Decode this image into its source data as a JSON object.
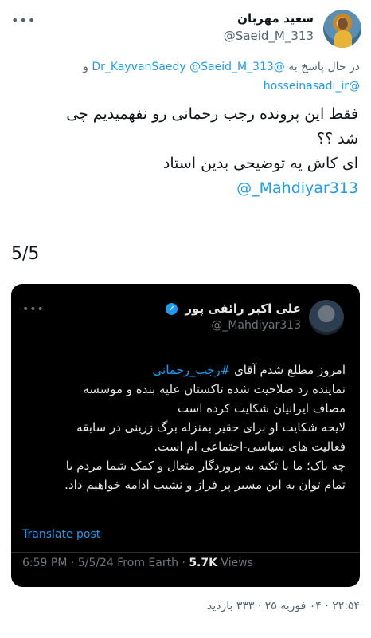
{
  "tweet": {
    "display_name": "سعید مهربان",
    "handle": "@Saeid_M_313",
    "more_icon": "more-horizontal-icon",
    "replying_prefix": "در حال پاسخ به",
    "replying_to": [
      "@Saeid_M_313",
      "@Dr_KayvanSaedy"
    ],
    "replying_and": "و",
    "replying_last": "@hosseinasadi_ir",
    "text_lines": [
      "فقط این پرونده رجب رحمانی رو نفهمیدیم چی",
      "شد ؟؟",
      "ای کاش یه توضیحی بدین استاد"
    ],
    "text_mention": "@_Mahdiyar313",
    "page_count": "5/5",
    "footer": "۲۲:۵۴ · ۰۴ فوریه ۲۵ · ۳۳۳ بازدید"
  },
  "quote": {
    "display_name": "علی اکبر رائفی پور",
    "handle": "@_Mahdiyar313",
    "verified_icon": "verified-badge-icon",
    "text_line1_prefix": "امروز مطلع شدم آقای",
    "hashtag": "#رجب_رحمانی",
    "text_lines": [
      "نماینده رد صلاحیت شده تاکستان علیه بنده و موسسه",
      "مصاف ایرانیان شکایت کرده است",
      "لایحه شکایت او  برای حقیر بمنزله برگ زرینی در سابقه",
      "فعالیت های سیاسی-اجتماعی ام است.",
      "چه باک؛ ما با تکیه به پروردگار متعال و کمک شما مردم با",
      "تمام توان به این مسیر پر فراز و نشیب ادامه خواهیم داد."
    ],
    "translate_label": "Translate post",
    "meta_time": "6:59 PM · 5/5/24 From Earth ·",
    "meta_views_count": "5.7K",
    "meta_views_label": "Views"
  },
  "colors": {
    "accent": "#1d9bf0",
    "muted": "#536471",
    "quote_bg": "#000000"
  }
}
